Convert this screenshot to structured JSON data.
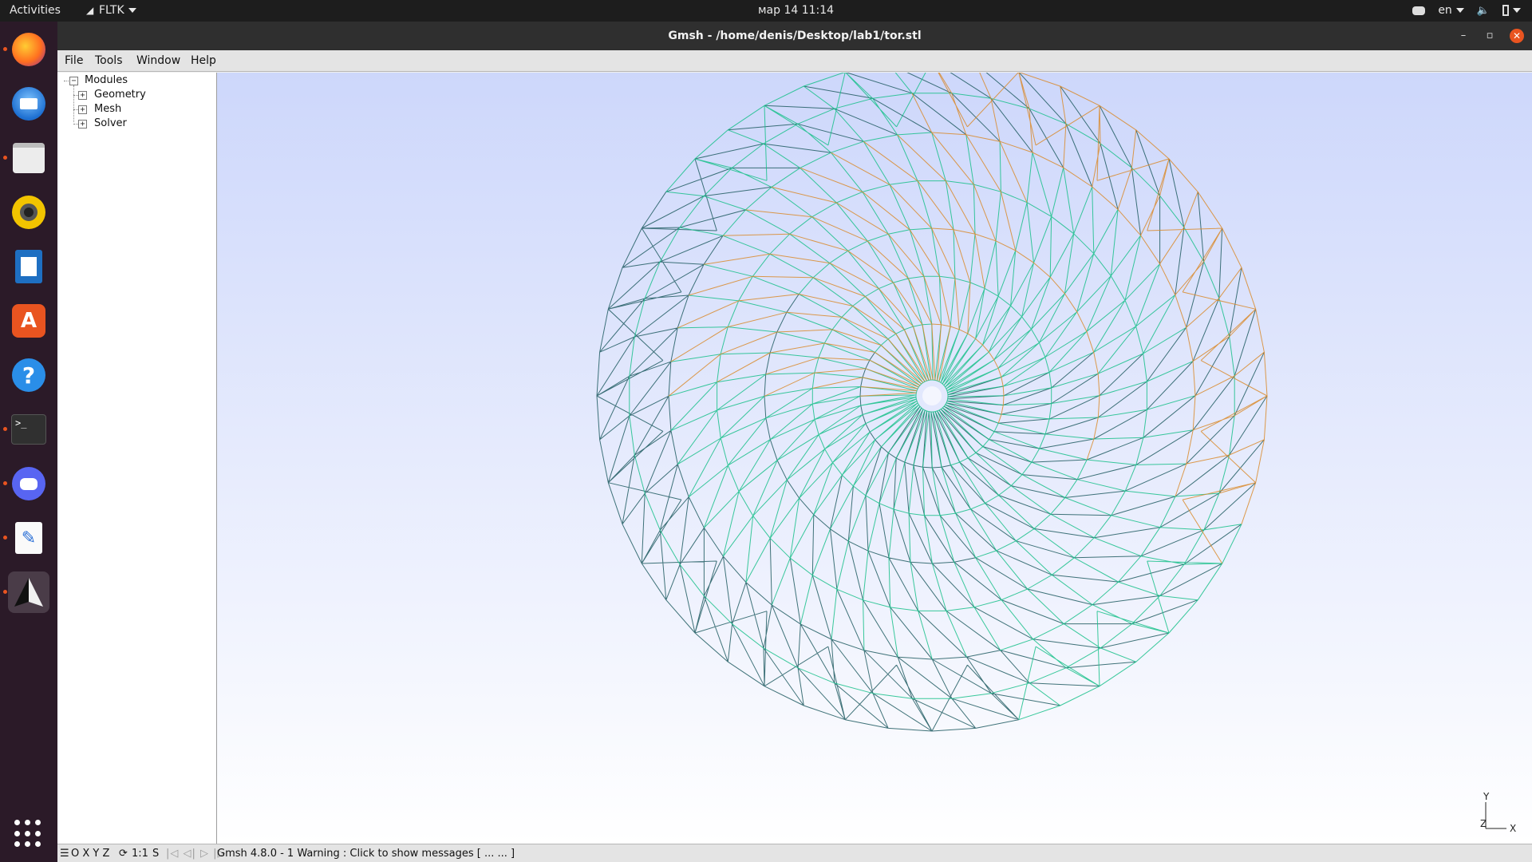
{
  "topbar": {
    "activities": "Activities",
    "app_menu": "FLTK",
    "clock": "мар 14  11:14",
    "language": "en"
  },
  "dock": {
    "items": [
      {
        "name": "firefox-icon",
        "running": true
      },
      {
        "name": "thunderbird-icon",
        "running": false
      },
      {
        "name": "files-icon",
        "running": true
      },
      {
        "name": "rhythmbox-icon",
        "running": false
      },
      {
        "name": "libreoffice-writer-icon",
        "running": false
      },
      {
        "name": "software-center-icon",
        "running": false
      },
      {
        "name": "help-icon",
        "running": false
      },
      {
        "name": "terminal-icon",
        "running": true
      },
      {
        "name": "discord-icon",
        "running": true
      },
      {
        "name": "text-editor-icon",
        "running": true
      },
      {
        "name": "gmsh-icon",
        "running": true,
        "active": true
      }
    ],
    "show_apps": "apps-grid-icon"
  },
  "window": {
    "title": "Gmsh - /home/denis/Desktop/lab1/tor.stl"
  },
  "menubar": {
    "file": "File",
    "tools": "Tools",
    "window": "Window",
    "help": "Help"
  },
  "tree": {
    "root": "Modules",
    "children": [
      "Geometry",
      "Mesh",
      "Solver"
    ]
  },
  "statusbar": {
    "view_buttons": "O X Y Z",
    "scale_button": "1:1",
    "s_button": "S",
    "message": "Gmsh 4.8.0  -   1 Warning : Click to show messages [ ...   ... ]"
  },
  "axes": {
    "y": "Y",
    "z": "Z",
    "x": "X"
  },
  "colors": {
    "accent": "#e95420",
    "viewport_top": "#cdd7fb",
    "viewport_bottom": "#ffffff",
    "mesh_dark": "#1f5a60",
    "mesh_green": "#18c08a",
    "mesh_orange": "#d98a2a"
  }
}
